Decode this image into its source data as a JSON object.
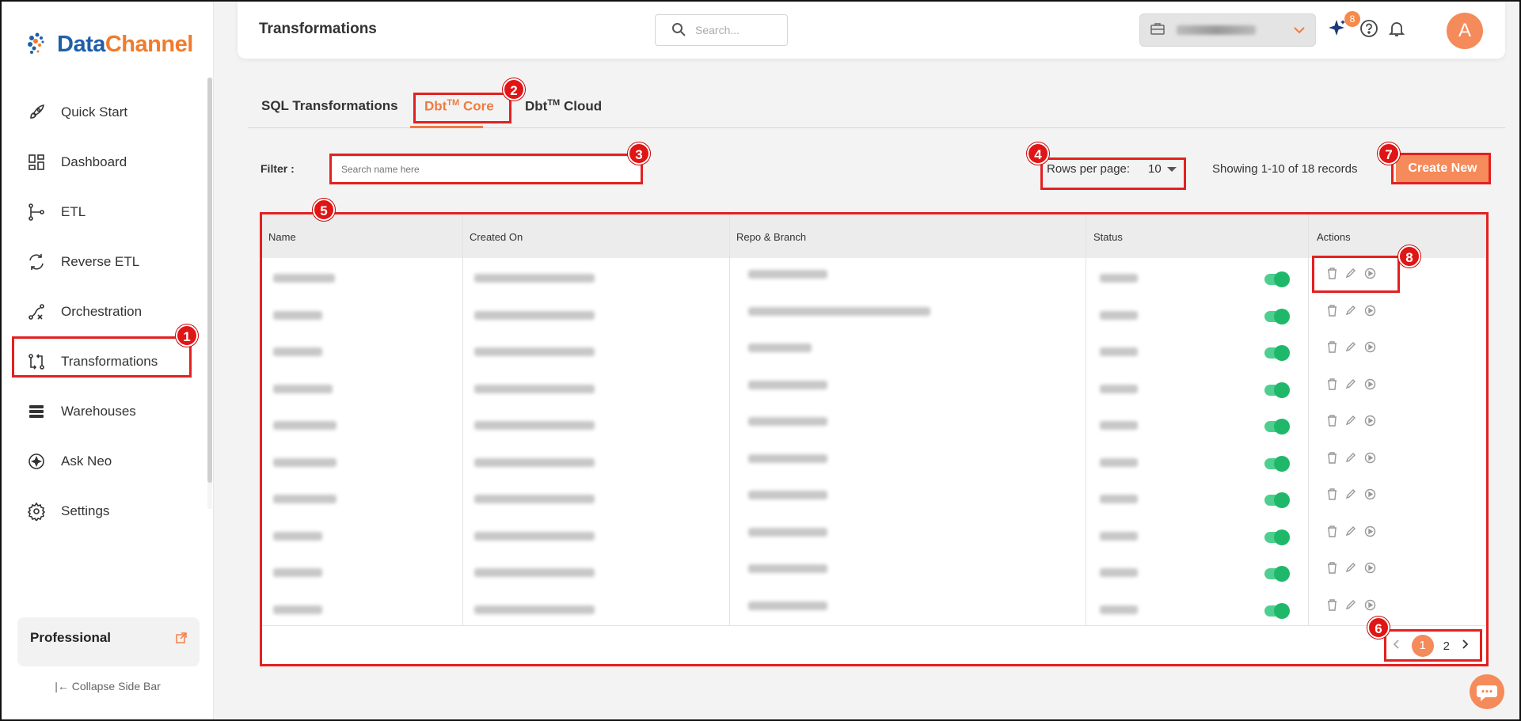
{
  "app": {
    "logo_part1": "Data",
    "logo_part2": "Channel"
  },
  "sidebar": {
    "items": [
      {
        "label": "Quick Start",
        "icon": "rocket-icon"
      },
      {
        "label": "Dashboard",
        "icon": "dashboard-grid-icon"
      },
      {
        "label": "ETL",
        "icon": "etl-flow-icon"
      },
      {
        "label": "Reverse ETL",
        "icon": "reverse-etl-icon"
      },
      {
        "label": "Orchestration",
        "icon": "orchestration-icon"
      },
      {
        "label": "Transformations",
        "icon": "transformations-icon"
      },
      {
        "label": "Warehouses",
        "icon": "warehouses-icon"
      },
      {
        "label": "Ask Neo",
        "icon": "sparkle-icon"
      },
      {
        "label": "Settings",
        "icon": "gear-icon"
      }
    ],
    "plan_label": "Professional",
    "collapse_label": "Collapse Side Bar"
  },
  "header": {
    "title": "Transformations",
    "search_placeholder": "Search...",
    "notification_count": "8",
    "avatar_initial": "A"
  },
  "tabs": [
    {
      "label": "SQL Transformations",
      "sup": ""
    },
    {
      "label_pre": "Dbt",
      "sup": "TM",
      "label_post": " Core"
    },
    {
      "label_pre": "Dbt",
      "sup": "TM",
      "label_post": " Cloud"
    }
  ],
  "filter": {
    "label": "Filter :",
    "placeholder": "Search name here",
    "rows_per_page_label": "Rows per page:",
    "rows_per_page_value": "10",
    "records_text": "Showing 1-10 of 18 records",
    "create_button": "Create New"
  },
  "table": {
    "columns": [
      "Name",
      "Created On",
      "Repo & Branch",
      "Status",
      "Actions"
    ],
    "row_count": 10
  },
  "pagination": {
    "pages": [
      "1",
      "2"
    ],
    "current": "1"
  },
  "annotations": [
    "1",
    "2",
    "3",
    "4",
    "5",
    "6",
    "7",
    "8"
  ]
}
